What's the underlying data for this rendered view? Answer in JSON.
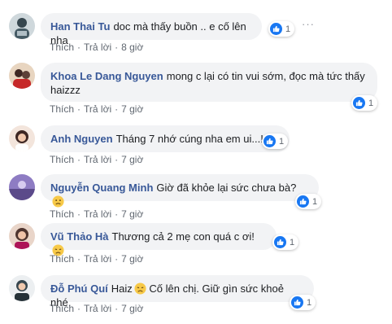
{
  "comments": [
    {
      "author": "Han Thai Tu",
      "text": "doc mà thấy buồn .. e cố lên nha",
      "emoji": null,
      "likes": "1",
      "like_label": "Thích",
      "reply_label": "Trả lời",
      "time": "8 giờ",
      "avatar_icon": "avatar-photo",
      "more_icon": "more-dots-icon"
    },
    {
      "author": "Khoa Le Dang Nguyen",
      "text": "mong c lại có tin vui sớm, đọc mà tức thấy haizzz",
      "emoji": null,
      "likes": "1",
      "like_label": "Thích",
      "reply_label": "Trả lời",
      "time": "7 giờ",
      "avatar_icon": "avatar-photo"
    },
    {
      "author": "Anh Nguyen",
      "text": "Tháng 7 nhớ cúng nha em ui...!",
      "emoji": null,
      "likes": "1",
      "like_label": "Thích",
      "reply_label": "Trả lời",
      "time": "7 giờ",
      "avatar_icon": "avatar-photo"
    },
    {
      "author": "Nguyễn Quang Minh",
      "text": "Giờ đã khỏe lại sức chưa bà?",
      "emoji": "confused-face",
      "likes": "1",
      "like_label": "Thích",
      "reply_label": "Trả lời",
      "time": "7 giờ",
      "avatar_icon": "avatar-photo"
    },
    {
      "author": "Vũ Thảo Hà",
      "text": "Thương cả 2 mẹ con quá c ơi!",
      "emoji": "disappointed-face",
      "likes": "1",
      "like_label": "Thích",
      "reply_label": "Trả lời",
      "time": "7 giờ",
      "avatar_icon": "avatar-photo"
    },
    {
      "author": "Đỗ Phú Quí",
      "text": "Haiz",
      "emoji": "disappointed-face",
      "text2": "Cố lên chị. Giữ gìn sức khoẻ nhé.",
      "likes": "1",
      "like_label": "Thích",
      "reply_label": "Trả lời",
      "time": "7 giờ",
      "avatar_icon": "avatar-photo"
    }
  ],
  "colors": {
    "author": "#385898",
    "bubble": "#f2f3f5",
    "like_blue": "#1877f2",
    "meta": "#606770"
  },
  "separator": "·"
}
